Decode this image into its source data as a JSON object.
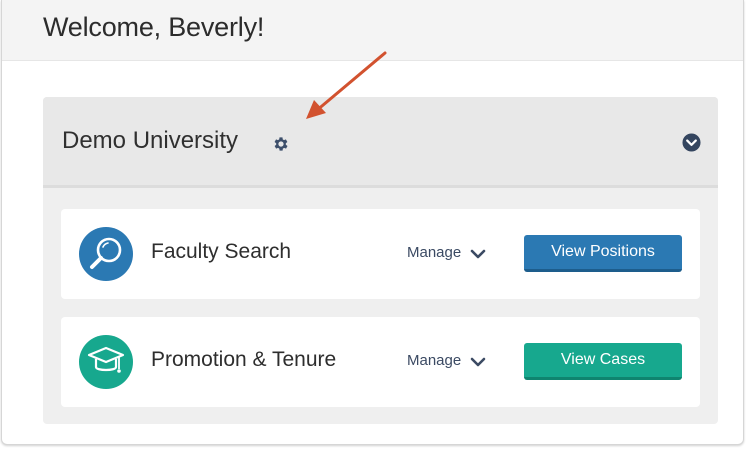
{
  "header": {
    "welcome": "Welcome, Beverly!"
  },
  "card": {
    "org_name": "Demo University",
    "icons": {
      "settings": "gear-icon",
      "collapse": "chevron-circle-down-icon"
    }
  },
  "modules": [
    {
      "title": "Faculty Search",
      "manage_label": "Manage",
      "button_label": "View Positions",
      "icon": "magnifier-icon",
      "color": "#2b79b3"
    },
    {
      "title": "Promotion & Tenure",
      "manage_label": "Manage",
      "button_label": "View Cases",
      "icon": "graduation-cap-icon",
      "color": "#17a88e"
    }
  ],
  "annotation": {
    "arrow_color": "#d2522f"
  },
  "colors": {
    "accent_blue": "#2b79b3",
    "accent_green": "#17a88e",
    "text_dark": "#2e2e2e"
  }
}
